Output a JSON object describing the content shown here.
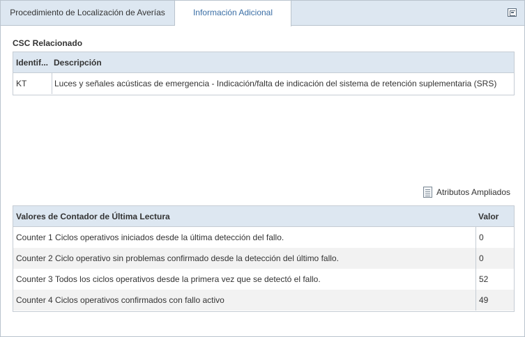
{
  "tabs": [
    {
      "label": "Procedimiento de Localización de Averías",
      "active": false
    },
    {
      "label": "Información Adicional",
      "active": true
    }
  ],
  "collapse_button": {
    "icon": "collapse-panel-icon"
  },
  "csc_section": {
    "title": "CSC Relacionado",
    "columns": [
      "Identif...",
      "Descripción"
    ],
    "rows": [
      {
        "id": "KT",
        "description": "Luces y señales acústicas de emergencia - Indicación/falta de indicación del sistema de retención suplementaria (SRS)"
      }
    ]
  },
  "extended_attributes": {
    "label": "Atributos Ampliados",
    "icon": "document-icon"
  },
  "counters": {
    "columns": [
      "Valores de Contador de Última Lectura",
      "Valor"
    ],
    "rows": [
      {
        "name": "Counter 1 Ciclos operativos iniciados desde la última detección del fallo.",
        "value": "0"
      },
      {
        "name": "Counter 2 Ciclo operativo sin problemas confirmado desde la detección del último fallo.",
        "value": "0"
      },
      {
        "name": "Counter 3 Todos los ciclos operativos desde la primera vez que se detectó el fallo.",
        "value": "52"
      },
      {
        "name": "Counter 4 Ciclos operativos confirmados con fallo activo",
        "value": "49"
      }
    ]
  },
  "colors": {
    "header_bg": "#dde7f1",
    "active_tab_text": "#3a6ea5",
    "border": "#b9c3cd",
    "alt_row": "#f2f2f2"
  }
}
